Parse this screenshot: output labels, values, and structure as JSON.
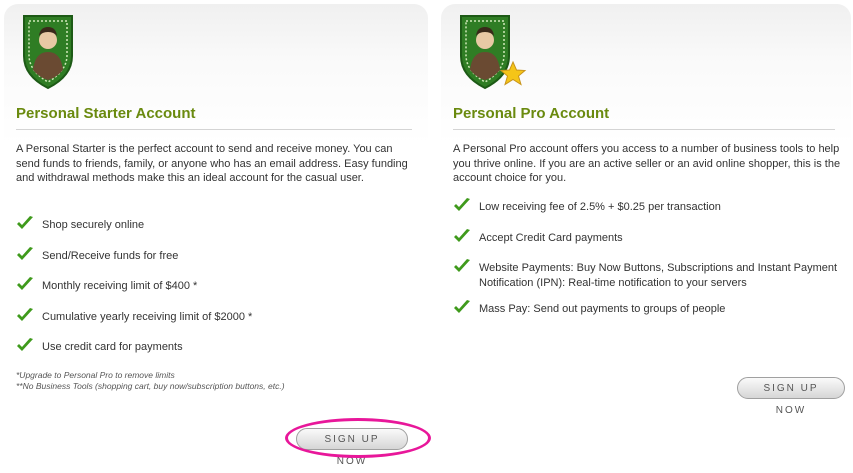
{
  "plans": [
    {
      "title": "Personal Starter Account",
      "description": "A Personal Starter is the perfect account to send and receive money. You can send funds to friends, family, or anyone who has an email address. Easy funding and withdrawal methods make this an ideal account for the casual user.",
      "features": [
        "Shop securely online",
        "Send/Receive funds for free",
        "Monthly receiving limit of $400 *",
        "Cumulative yearly receiving limit of $2000 *",
        "Use credit card for payments"
      ],
      "footnotes": [
        "*Upgrade to Personal Pro to remove limits",
        "**No Business Tools (shopping cart, buy now/subscription buttons, etc.)"
      ],
      "button_label": "SIGN UP NOW"
    },
    {
      "title": "Personal Pro Account",
      "description": "A Personal Pro account offers you access to a number of business tools to help you thrive online. If you are an active seller or an avid online shopper, this is the account choice for you.",
      "features": [
        "Low receiving fee of 2.5% + $0.25 per transaction",
        "Accept Credit Card payments",
        "Website Payments: Buy Now Buttons, Subscriptions and Instant Payment Notification (IPN): Real-time notification to your servers",
        "Mass Pay: Send out payments to groups of people"
      ],
      "button_label": "SIGN UP NOW"
    }
  ],
  "colors": {
    "title_green": "#6a8a0f",
    "check_green": "#3f9a1c",
    "highlight_pink": "#e8179a",
    "shield_green": "#3c8a2a"
  },
  "icons": {
    "badge": "user-shield-icon",
    "pro_badge_extra": "star-icon",
    "bullet": "checkmark-icon"
  }
}
